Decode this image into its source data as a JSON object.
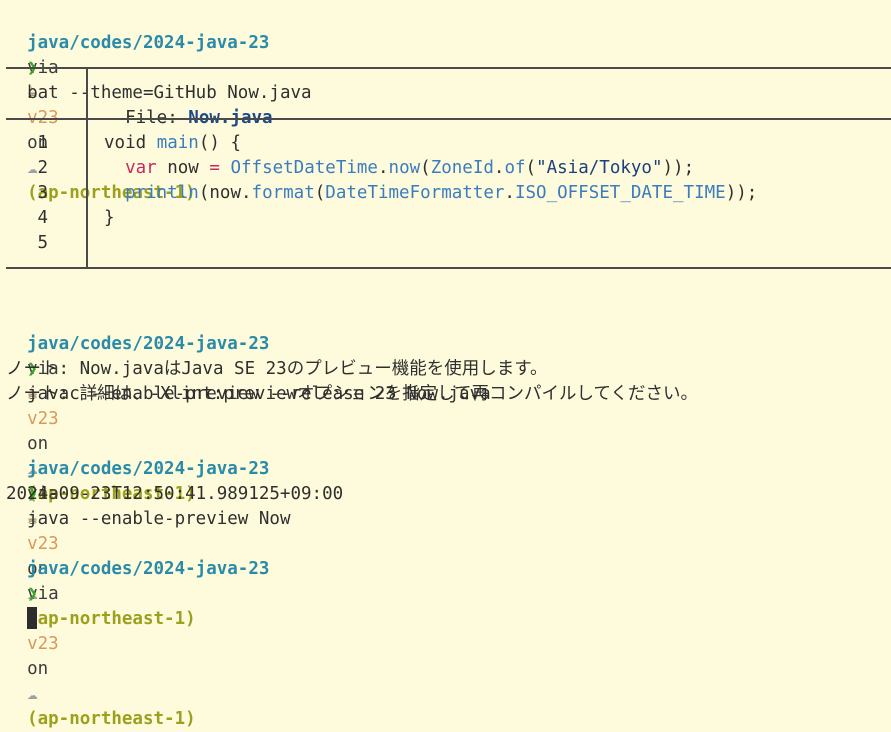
{
  "prompt": {
    "path": "java/codes/2024-java-23",
    "via": "via",
    "java_icon": "☕",
    "java_version": "v23",
    "on": "on",
    "cloud_icon": "☁",
    "region": "(ap-northeast-1)",
    "symbol": "❯"
  },
  "commands": [
    "bat --theme=GitHub Now.java",
    "javac --enable-preview --release 23 Now.java",
    "java --enable-preview Now"
  ],
  "bat": {
    "file_label": "File: ",
    "file_name": "Now.java",
    "line_numbers": [
      "1",
      "2",
      "3",
      "4",
      "5"
    ],
    "code": {
      "l1_kw": "void ",
      "l1_fn": "main",
      "l1_rest": "() {",
      "l2_indent": "  ",
      "l2_var": "var",
      "l2_now": " now ",
      "l2_eq": "=",
      "l2_sp": " ",
      "l2_cls1": "OffsetDateTime",
      "l2_dot1": ".",
      "l2_fn1": "now",
      "l2_p1": "(",
      "l2_cls2": "ZoneId",
      "l2_dot2": ".",
      "l2_fn2": "of",
      "l2_p2": "(",
      "l2_str": "\"Asia/Tokyo\"",
      "l2_end": "));",
      "l3_indent": "  ",
      "l3_fn1": "println",
      "l3_p1": "(now.",
      "l3_fn2": "format",
      "l3_p2": "(",
      "l3_cls": "DateTimeFormatter",
      "l3_dot": ".",
      "l3_const": "ISO_OFFSET_DATE_TIME",
      "l3_end": "));",
      "l4": "}"
    }
  },
  "javac_output": [
    "ノート: Now.javaはJava SE 23のプレビュー機能を使用します。",
    "ノート: 詳細は、-Xlint:previewオプションを指定して再コンパイルしてください。"
  ],
  "java_output": "2024-09-23T12:50:41.989125+09:00"
}
